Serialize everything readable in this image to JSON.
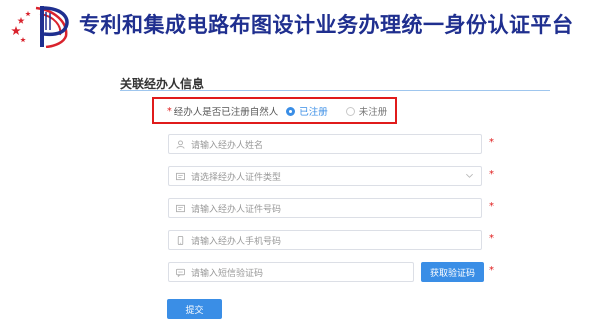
{
  "header": {
    "title": "专利和集成电路布图设计业务办理统一身份认证平台",
    "logo": "cnipa-logo"
  },
  "section": {
    "title": "关联经办人信息"
  },
  "registered": {
    "required_mark": "*",
    "label": "经办人是否已注册自然人",
    "options": [
      {
        "label": "已注册",
        "selected": true
      },
      {
        "label": "未注册",
        "selected": false
      }
    ]
  },
  "fields": {
    "name": {
      "placeholder": "请输入经办人姓名",
      "icon": "user-icon",
      "required_mark": "*"
    },
    "id_type": {
      "placeholder": "请选择经办人证件类型",
      "icon": "id-card-icon",
      "required_mark": "*"
    },
    "id_number": {
      "placeholder": "请输入经办人证件号码",
      "icon": "id-card-icon",
      "required_mark": "*"
    },
    "phone": {
      "placeholder": "请输入经办人手机号码",
      "icon": "phone-icon",
      "required_mark": "*"
    },
    "sms_code": {
      "placeholder": "请输入短信验证码",
      "icon": "message-icon",
      "required_mark": "*"
    }
  },
  "buttons": {
    "get_code": "获取验证码",
    "submit": "提交"
  },
  "colors": {
    "brand": "#1f2f8f",
    "primary": "#3a8ee6",
    "highlight": "#e01b1b",
    "divider": "#9fc6ee"
  }
}
